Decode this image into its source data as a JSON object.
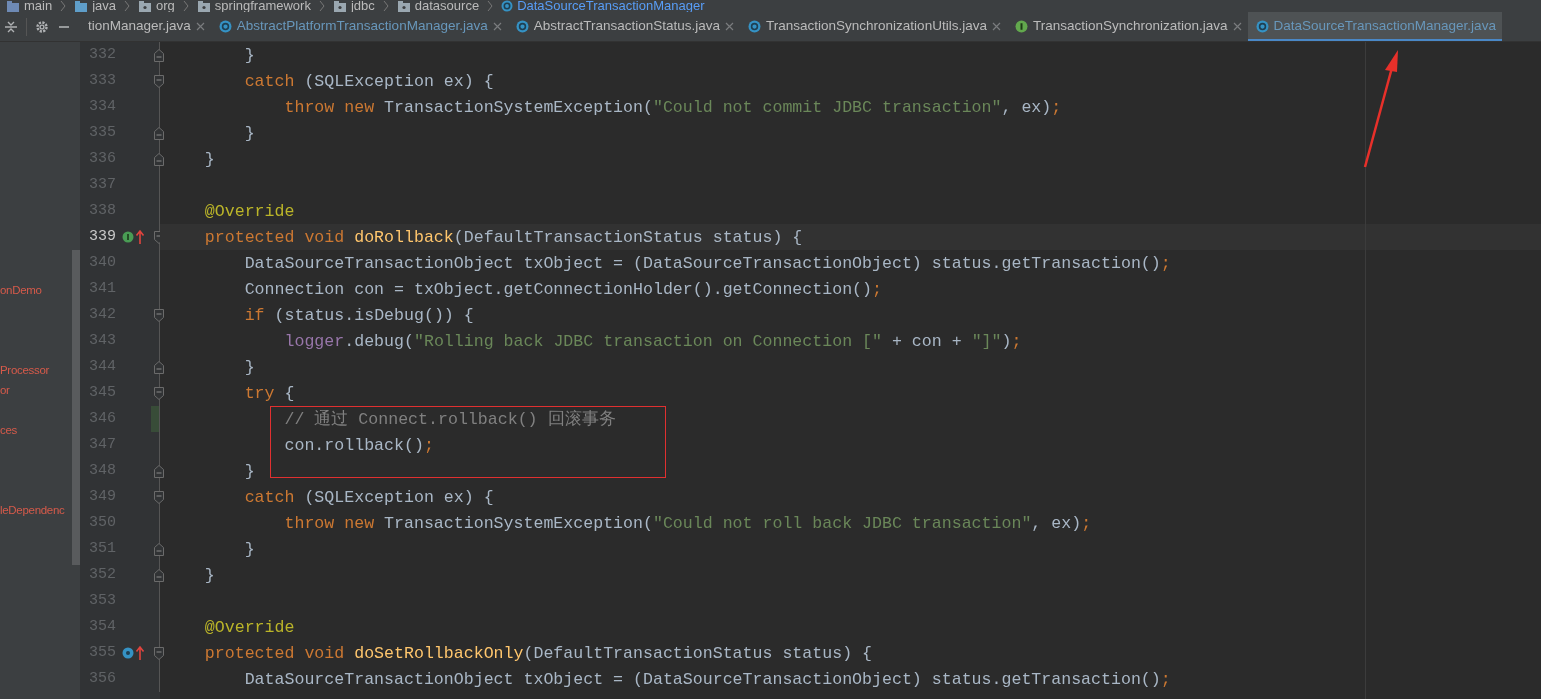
{
  "breadcrumb": [
    {
      "label": "main",
      "kind": "module",
      "current": false
    },
    {
      "label": "java",
      "kind": "source-folder",
      "current": false
    },
    {
      "label": "org",
      "kind": "package",
      "current": false
    },
    {
      "label": "springframework",
      "kind": "package",
      "current": false
    },
    {
      "label": "jdbc",
      "kind": "package",
      "current": false
    },
    {
      "label": "datasource",
      "kind": "package",
      "current": false
    },
    {
      "label": "DataSourceTransactionManager",
      "kind": "class",
      "current": true
    }
  ],
  "tabs": [
    {
      "label": "tionManager.java",
      "kind": "file",
      "modified": false,
      "selected": false,
      "closable": true
    },
    {
      "label": "AbstractPlatformTransactionManager.java",
      "kind": "class",
      "modified": true,
      "selected": false,
      "closable": true
    },
    {
      "label": "AbstractTransactionStatus.java",
      "kind": "class",
      "modified": false,
      "selected": false,
      "closable": true
    },
    {
      "label": "TransactionSynchronizationUtils.java",
      "kind": "class",
      "modified": false,
      "selected": false,
      "closable": true
    },
    {
      "label": "TransactionSynchronization.java",
      "kind": "interface",
      "modified": false,
      "selected": false,
      "closable": true
    },
    {
      "label": "DataSourceTransactionManager.java",
      "kind": "class",
      "modified": true,
      "selected": true,
      "closable": false
    }
  ],
  "sidebar": {
    "items": [
      {
        "label": "onDemo"
      },
      {
        "label": "Processor"
      },
      {
        "label": "or"
      },
      {
        "label": "ces"
      },
      {
        "label": "leDependenc"
      }
    ]
  },
  "editor": {
    "lines": [
      {
        "number": "332",
        "current": false,
        "changed": false,
        "fold_start": false,
        "fold_end": true,
        "implements_marker": false,
        "override_marker": false,
        "tokens": [
          {
            "kind": "plain",
            "text": "        }"
          }
        ]
      },
      {
        "number": "333",
        "current": false,
        "changed": false,
        "fold_start": true,
        "fold_end": false,
        "implements_marker": false,
        "override_marker": false,
        "tokens": [
          {
            "kind": "keyword",
            "text": "        catch"
          },
          {
            "kind": "plain",
            "text": " (SQLException ex) {"
          }
        ]
      },
      {
        "number": "334",
        "current": false,
        "changed": false,
        "fold_start": false,
        "fold_end": false,
        "implements_marker": false,
        "override_marker": false,
        "tokens": [
          {
            "kind": "keyword",
            "text": "            throw new"
          },
          {
            "kind": "plain",
            "text": " TransactionSystemException("
          },
          {
            "kind": "string",
            "text": "\"Could not commit JDBC transaction\""
          },
          {
            "kind": "plain",
            "text": ", ex)"
          },
          {
            "kind": "keyword",
            "text": ";"
          }
        ]
      },
      {
        "number": "335",
        "current": false,
        "changed": false,
        "fold_start": false,
        "fold_end": true,
        "implements_marker": false,
        "override_marker": false,
        "tokens": [
          {
            "kind": "plain",
            "text": "        }"
          }
        ]
      },
      {
        "number": "336",
        "current": false,
        "changed": false,
        "fold_start": false,
        "fold_end": true,
        "implements_marker": false,
        "override_marker": false,
        "tokens": [
          {
            "kind": "plain",
            "text": "    }"
          }
        ]
      },
      {
        "number": "337",
        "current": false,
        "changed": false,
        "fold_start": false,
        "fold_end": false,
        "implements_marker": false,
        "override_marker": false
      },
      {
        "number": "338",
        "current": false,
        "changed": false,
        "fold_start": false,
        "fold_end": false,
        "implements_marker": false,
        "override_marker": false,
        "tokens": [
          {
            "kind": "annotation",
            "text": "    @Override"
          }
        ]
      },
      {
        "number": "339",
        "current": true,
        "changed": false,
        "fold_start": true,
        "fold_end": false,
        "implements_marker": true,
        "override_marker": false,
        "tokens": [
          {
            "kind": "keyword",
            "text": "    protected void "
          },
          {
            "kind": "method",
            "text": "doRollback"
          },
          {
            "kind": "plain",
            "text": "(DefaultTransactionStatus status) {"
          }
        ]
      },
      {
        "number": "340",
        "current": false,
        "changed": false,
        "fold_start": false,
        "fold_end": false,
        "implements_marker": false,
        "override_marker": false,
        "tokens": [
          {
            "kind": "plain",
            "text": "        DataSourceTransactionObject txObject = (DataSourceTransactionObject) status.getTransaction()"
          },
          {
            "kind": "keyword",
            "text": ";"
          }
        ]
      },
      {
        "number": "341",
        "current": false,
        "changed": false,
        "fold_start": false,
        "fold_end": false,
        "implements_marker": false,
        "override_marker": false,
        "tokens": [
          {
            "kind": "plain",
            "text": "        Connection con = txObject.getConnectionHolder().getConnection()"
          },
          {
            "kind": "keyword",
            "text": ";"
          }
        ]
      },
      {
        "number": "342",
        "current": false,
        "changed": false,
        "fold_start": true,
        "fold_end": false,
        "implements_marker": false,
        "override_marker": false,
        "tokens": [
          {
            "kind": "keyword",
            "text": "        if"
          },
          {
            "kind": "plain",
            "text": " (status.isDebug()) {"
          }
        ]
      },
      {
        "number": "343",
        "current": false,
        "changed": false,
        "fold_start": false,
        "fold_end": false,
        "implements_marker": false,
        "override_marker": false,
        "tokens": [
          {
            "kind": "field",
            "text": "            logger"
          },
          {
            "kind": "plain",
            "text": ".debug("
          },
          {
            "kind": "string",
            "text": "\"Rolling back JDBC transaction on Connection [\""
          },
          {
            "kind": "plain",
            "text": " + con + "
          },
          {
            "kind": "string",
            "text": "\"]\""
          },
          {
            "kind": "plain",
            "text": ")"
          },
          {
            "kind": "keyword",
            "text": ";"
          }
        ]
      },
      {
        "number": "344",
        "current": false,
        "changed": false,
        "fold_start": false,
        "fold_end": true,
        "implements_marker": false,
        "override_marker": false,
        "tokens": [
          {
            "kind": "plain",
            "text": "        }"
          }
        ]
      },
      {
        "number": "345",
        "current": false,
        "changed": false,
        "fold_start": true,
        "fold_end": false,
        "implements_marker": false,
        "override_marker": false,
        "tokens": [
          {
            "kind": "keyword",
            "text": "        try"
          },
          {
            "kind": "plain",
            "text": " {"
          }
        ]
      },
      {
        "number": "346",
        "current": false,
        "changed": true,
        "fold_start": false,
        "fold_end": false,
        "implements_marker": false,
        "override_marker": false,
        "tokens": [
          {
            "kind": "comment",
            "text": "            // 通过 Connect.rollback() 回滚事务"
          }
        ]
      },
      {
        "number": "347",
        "current": false,
        "changed": false,
        "fold_start": false,
        "fold_end": false,
        "implements_marker": false,
        "override_marker": false,
        "tokens": [
          {
            "kind": "plain",
            "text": "            con.rollback()"
          },
          {
            "kind": "keyword",
            "text": ";"
          }
        ]
      },
      {
        "number": "348",
        "current": false,
        "changed": false,
        "fold_start": false,
        "fold_end": true,
        "implements_marker": false,
        "override_marker": false,
        "tokens": [
          {
            "kind": "plain",
            "text": "        }"
          }
        ]
      },
      {
        "number": "349",
        "current": false,
        "changed": false,
        "fold_start": true,
        "fold_end": false,
        "implements_marker": false,
        "override_marker": false,
        "tokens": [
          {
            "kind": "keyword",
            "text": "        catch"
          },
          {
            "kind": "plain",
            "text": " (SQLException ex) {"
          }
        ]
      },
      {
        "number": "350",
        "current": false,
        "changed": false,
        "fold_start": false,
        "fold_end": false,
        "implements_marker": false,
        "override_marker": false,
        "tokens": [
          {
            "kind": "keyword",
            "text": "            throw new"
          },
          {
            "kind": "plain",
            "text": " TransactionSystemException("
          },
          {
            "kind": "string",
            "text": "\"Could not roll back JDBC transaction\""
          },
          {
            "kind": "plain",
            "text": ", ex)"
          },
          {
            "kind": "keyword",
            "text": ";"
          }
        ]
      },
      {
        "number": "351",
        "current": false,
        "changed": false,
        "fold_start": false,
        "fold_end": true,
        "implements_marker": false,
        "override_marker": false,
        "tokens": [
          {
            "kind": "plain",
            "text": "        }"
          }
        ]
      },
      {
        "number": "352",
        "current": false,
        "changed": false,
        "fold_start": false,
        "fold_end": true,
        "implements_marker": false,
        "override_marker": false,
        "tokens": [
          {
            "kind": "plain",
            "text": "    }"
          }
        ]
      },
      {
        "number": "353",
        "current": false,
        "changed": false,
        "fold_start": false,
        "fold_end": false,
        "implements_marker": false,
        "override_marker": false
      },
      {
        "number": "354",
        "current": false,
        "changed": false,
        "fold_start": false,
        "fold_end": false,
        "implements_marker": false,
        "override_marker": false,
        "tokens": [
          {
            "kind": "annotation",
            "text": "    @Override"
          }
        ]
      },
      {
        "number": "355",
        "current": false,
        "changed": false,
        "fold_start": true,
        "fold_end": false,
        "implements_marker": false,
        "override_marker": true,
        "tokens": [
          {
            "kind": "keyword",
            "text": "    protected void "
          },
          {
            "kind": "method",
            "text": "doSetRollbackOnly"
          },
          {
            "kind": "plain",
            "text": "(DefaultTransactionStatus status) {"
          }
        ]
      },
      {
        "number": "356",
        "current": false,
        "changed": false,
        "fold_start": false,
        "fold_end": false,
        "implements_marker": false,
        "override_marker": false,
        "tokens": [
          {
            "kind": "plain",
            "text": "        DataSourceTransactionObject txObject = (DataSourceTransactionObject) status.getTransaction()"
          },
          {
            "kind": "keyword",
            "text": ";"
          }
        ]
      }
    ]
  }
}
